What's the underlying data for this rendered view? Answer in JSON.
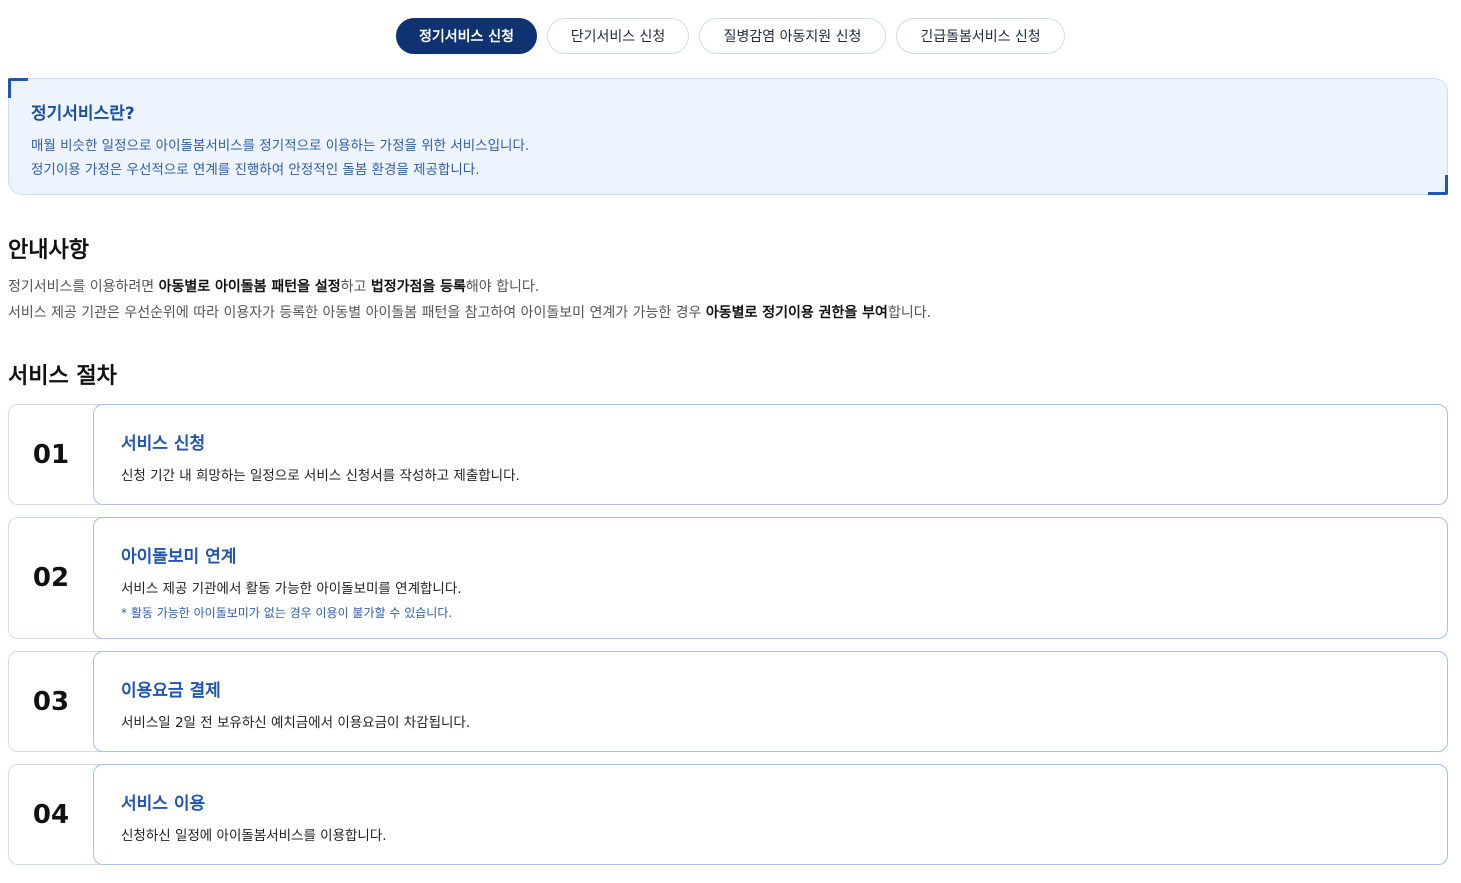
{
  "tabs": [
    {
      "label": "정기서비스 신청",
      "active": true
    },
    {
      "label": "단기서비스 신청",
      "active": false
    },
    {
      "label": "질병감염 아동지원 신청",
      "active": false
    },
    {
      "label": "긴급돌봄서비스 신청",
      "active": false
    }
  ],
  "intro": {
    "title": "정기서비스란?",
    "line1": "매월 비슷한 일정으로 아이돌봄서비스를 정기적으로 이용하는 가정을 위한 서비스입니다.",
    "line2": "정기이용 가정은 우선적으로 연계를 진행하여 안정적인 돌봄 환경을 제공합니다."
  },
  "notice": {
    "title": "안내사항",
    "p1": {
      "a": "정기서비스를 이용하려면 ",
      "b": "아동별로 아이돌봄 패턴을 설정",
      "c": "하고 ",
      "d": "법정가점을 등록",
      "e": "해야 합니다."
    },
    "p2": {
      "a": "서비스 제공 기관은 우선순위에 따라 이용자가 등록한 아동별 아이돌봄 패턴을 참고하여 아이돌보미 연계가 가능한 경우 ",
      "b": "아동별로 정기이용 권한을 부여",
      "c": "합니다."
    }
  },
  "procedure": {
    "title": "서비스 절차",
    "steps": [
      {
        "num": "01",
        "title": "서비스 신청",
        "desc": "신청 기간 내 희망하는 일정으로 서비스 신청서를 작성하고 제출합니다."
      },
      {
        "num": "02",
        "title": "아이돌보미 연계",
        "desc": "서비스 제공 기관에서 활동 가능한 아이돌보미를 연계합니다.",
        "note": "* 활동 가능한 아이돌보미가 없는 경우 이용이 불가할 수 있습니다."
      },
      {
        "num": "03",
        "title": "이용요금 결제",
        "desc": "서비스일 2일 전 보유하신 예치금에서 이용요금이 차감됩니다."
      },
      {
        "num": "04",
        "title": "서비스 이용",
        "desc": "신청하신 일정에 아이돌봄서비스를 이용합니다."
      }
    ]
  }
}
